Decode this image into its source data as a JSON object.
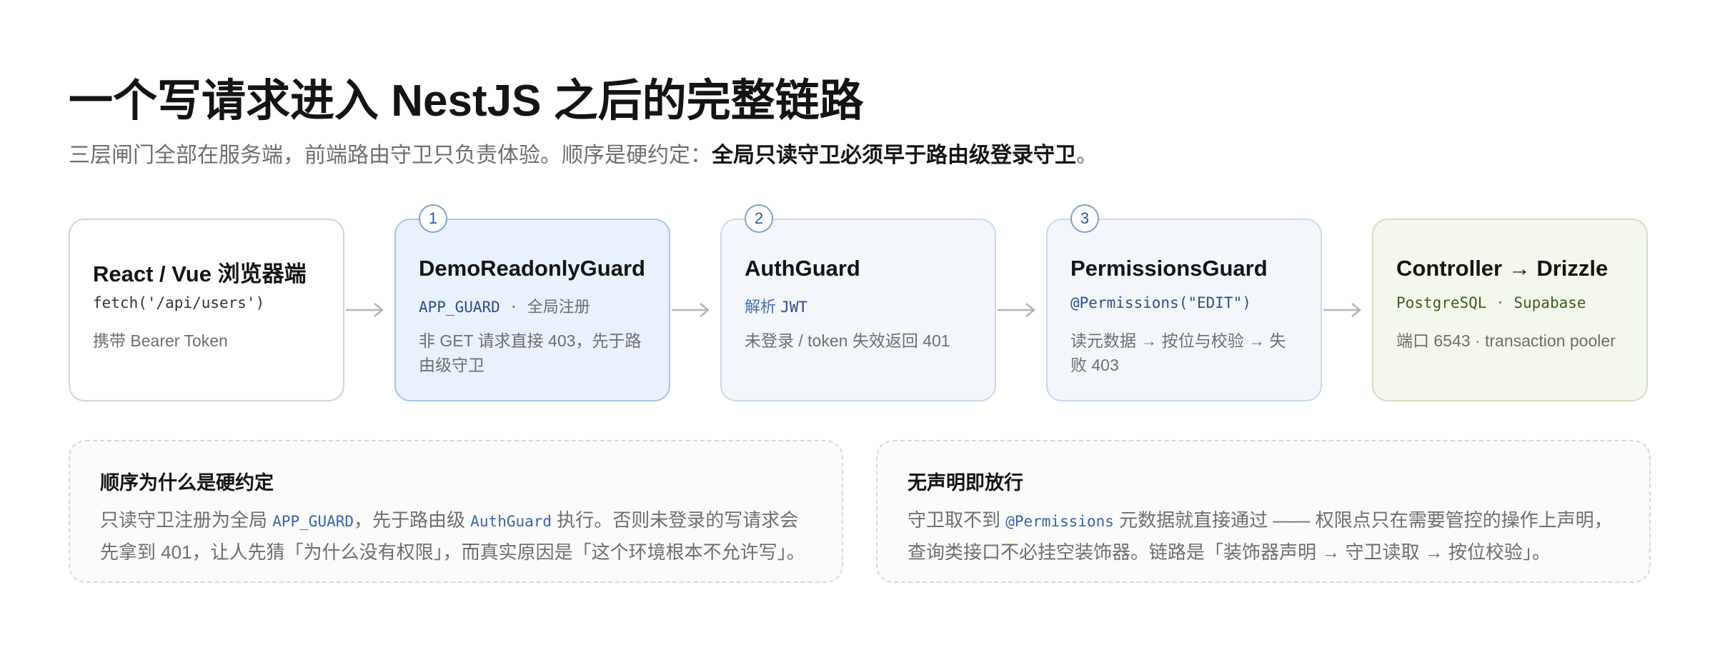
{
  "header": {
    "title": "一个写请求进入 NestJS 之后的完整链路",
    "subtitle_plain": "三层闸门全部在服务端，前端路由守卫只负责体验。顺序是硬约定：",
    "subtitle_bold": "全局只读守卫必须早于路由级登录守卫",
    "subtitle_end": "。"
  },
  "steps": [
    {
      "title": "React / Vue 浏览器端",
      "code": "fetch('/api/users')",
      "desc": "携带 Bearer Token"
    },
    {
      "badge": "1",
      "title": "DemoReadonlyGuard",
      "code": "APP_GUARD",
      "code_sep": " · ",
      "code_note": "全局注册",
      "desc": "非 GET 请求直接 403，先于路由级守卫"
    },
    {
      "badge": "2",
      "title": "AuthGuard",
      "code_prefix": "解析 ",
      "code": "JWT",
      "desc": "未登录 / token 失效返回 401"
    },
    {
      "badge": "3",
      "title": "PermissionsGuard",
      "code": "@Permissions(\"EDIT\")",
      "desc": "读元数据 → 按位与校验 → 失败 403"
    },
    {
      "title": "Controller → Drizzle",
      "code": "PostgreSQL",
      "code_sep": " · ",
      "code_note": "Supabase",
      "desc": "端口 6543 · transaction pooler"
    }
  ],
  "notes": [
    {
      "title": "顺序为什么是硬约定",
      "p1": "只读守卫注册为全局 ",
      "c1": "APP_GUARD",
      "p2": "，先于路由级 ",
      "c2": "AuthGuard",
      "p3": " 执行。否则未登录的写请求会先拿到 401，让人先猜「为什么没有权限」，而真实原因是「这个环境根本不允许写」。"
    },
    {
      "title": "无声明即放行",
      "p1": "守卫取不到 ",
      "c1": "@Permissions",
      "p2": " 元数据就直接通过 —— 权限点只在需要管控的操作上声明，查询类接口不必挂空装饰器。链路是「装饰器声明 → 守卫读取 → 按位校验」。"
    }
  ],
  "colors": {
    "active_fill": "#e9f1fc",
    "guard_fill": "#f3f7fc",
    "db_fill": "#f4f8ec",
    "badge_border": "#7fa2cf",
    "code_blue": "#3a63a8"
  }
}
